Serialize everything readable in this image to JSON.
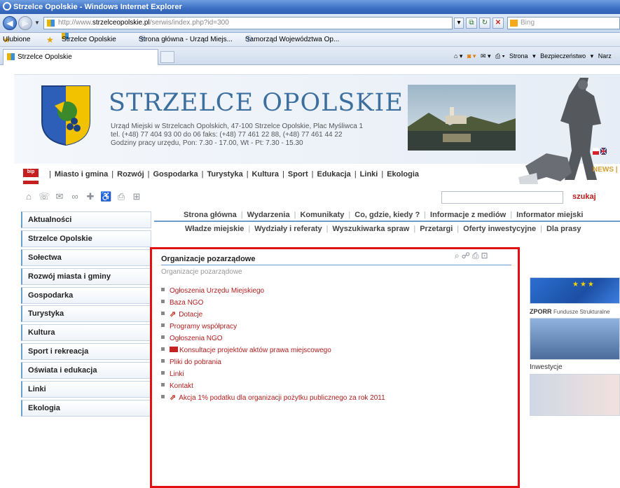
{
  "window": {
    "title": "Strzelce Opolskie - Windows Internet Explorer",
    "url_prefix": "http://www.",
    "url_domain": "strzelceopolskie.pl",
    "url_path": "/serwis/index.php?id=300",
    "search_placeholder": "Bing"
  },
  "favorites_bar": {
    "favorites_label": "Ulubione",
    "links": [
      "Strzelce Opolskie",
      "Strona główna - Urząd Miejs...",
      "Samorząd Województwa Op..."
    ]
  },
  "tabs": [
    {
      "label": "Strzelce Opolskie"
    }
  ],
  "command_bar": {
    "page_label": "Strona",
    "security_label": "Bezpieczeństwo",
    "tools_label": "Narz"
  },
  "header": {
    "site_title": "STRZELCE OPOLSKIE",
    "address_line1": "Urząd Miejski w Strzelcach Opolskich, 47-100 Strzelce Opolskie, Plac Myśliwca 1",
    "address_line2": "tel. (+48) 77 404 93 00 do 06 faks: (+48) 77 461 22 88, (+48) 77 461 44 22",
    "address_line3": "Godziny pracy urzędu, Pon: 7.30 - 17.00, Wt - Pt: 7.30 - 15.30",
    "news_label": "NEWS",
    "bip_label": "bip"
  },
  "main_nav": [
    "Miasto i gmina",
    "Rozwój",
    "Gospodarka",
    "Turystyka",
    "Kultura",
    "Sport",
    "Edukacja",
    "Linki",
    "Ekologia"
  ],
  "search": {
    "button_label": "szukaj"
  },
  "sub_nav_1": [
    "Strona główna",
    "Wydarzenia",
    "Komunikaty",
    "Co, gdzie, kiedy ?",
    "Informacje z mediów",
    "Informator miejski"
  ],
  "sub_nav_2": [
    "Władze miejskie",
    "Wydziały i referaty",
    "Wyszukiwarka spraw",
    "Przetargi",
    "Oferty inwestycyjne",
    "Dla prasy"
  ],
  "sidebar": [
    {
      "label": "Aktualności"
    },
    {
      "label": "Strzelce Opolskie"
    },
    {
      "label": "Sołectwa"
    },
    {
      "label": "Rozwój miasta i gminy"
    },
    {
      "label": "Gospodarka"
    },
    {
      "label": "Turystyka"
    },
    {
      "label": "Kultura"
    },
    {
      "label": "Sport i rekreacja"
    },
    {
      "label": "Oświata i edukacja"
    },
    {
      "label": "Linki"
    },
    {
      "label": "Ekologia"
    }
  ],
  "content": {
    "title": "Organizacje pozarządowe",
    "subtitle": "Organizacje pozarządowe",
    "items": [
      {
        "label": "Ogłoszenia Urzędu Miejskiego"
      },
      {
        "label": "Baza NGO"
      },
      {
        "label": "Dotacje"
      },
      {
        "label": "Programy współpracy"
      },
      {
        "label": "Ogłoszenia NGO"
      },
      {
        "label": "Konsultacje projektów aktów prawa miejscowego"
      },
      {
        "label": "Pliki do pobrania"
      },
      {
        "label": "Linki"
      },
      {
        "label": "Kontakt"
      },
      {
        "label": "Akcja 1% podatku dla organizacji pożytku publicznego za rok 2011"
      }
    ]
  },
  "right_banners": {
    "zporr_label": "ZPORR",
    "zporr_sub": "Fundusze Strukturalne",
    "investments_label": "Inwestycje"
  },
  "colors": {
    "accent_blue": "#3d6f9e",
    "link_red": "#b11d1d",
    "highlight_frame": "#e21010"
  }
}
